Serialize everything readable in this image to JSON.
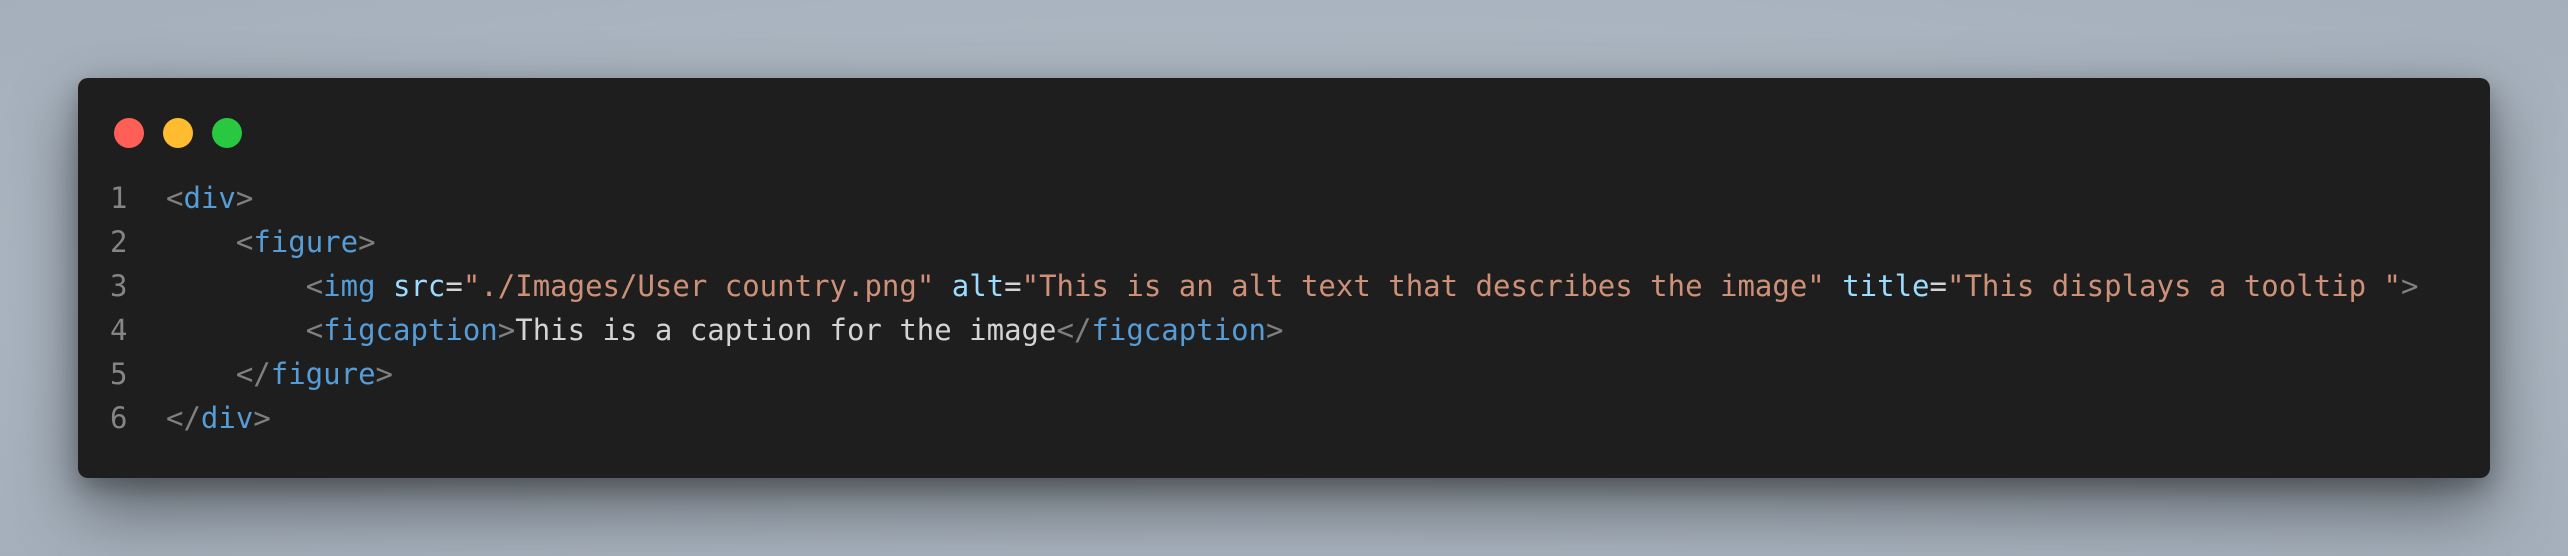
{
  "window": {
    "controls": {
      "close_color": "#ff5f57",
      "minimize_color": "#febc2e",
      "zoom_color": "#28c840"
    }
  },
  "theme": {
    "background": "#1e1e1e",
    "line_number": "#858585",
    "punctuation": "#808080",
    "tag": "#569cd6",
    "attribute": "#9cdcfe",
    "string": "#ce9178",
    "text": "#d4d4d4"
  },
  "code": {
    "lines": [
      {
        "number": "1",
        "indent": "",
        "tokens": [
          {
            "t": "punct",
            "v": "<"
          },
          {
            "t": "tag",
            "v": "div"
          },
          {
            "t": "punct",
            "v": ">"
          }
        ]
      },
      {
        "number": "2",
        "indent": "    ",
        "tokens": [
          {
            "t": "punct",
            "v": "<"
          },
          {
            "t": "tag",
            "v": "figure"
          },
          {
            "t": "punct",
            "v": ">"
          }
        ]
      },
      {
        "number": "3",
        "indent": "        ",
        "tokens": [
          {
            "t": "punct",
            "v": "<"
          },
          {
            "t": "tag",
            "v": "img"
          },
          {
            "t": "text",
            "v": " "
          },
          {
            "t": "attr",
            "v": "src"
          },
          {
            "t": "eq",
            "v": "="
          },
          {
            "t": "str",
            "v": "\"./Images/User country.png\""
          },
          {
            "t": "text",
            "v": " "
          },
          {
            "t": "attr",
            "v": "alt"
          },
          {
            "t": "eq",
            "v": "="
          },
          {
            "t": "str",
            "v": "\"This is an alt text that describes the image\""
          },
          {
            "t": "text",
            "v": " "
          },
          {
            "t": "attr",
            "v": "title"
          },
          {
            "t": "eq",
            "v": "="
          },
          {
            "t": "str",
            "v": "\"This displays a tooltip \""
          },
          {
            "t": "punct",
            "v": ">"
          }
        ]
      },
      {
        "number": "4",
        "indent": "        ",
        "tokens": [
          {
            "t": "punct",
            "v": "<"
          },
          {
            "t": "tag",
            "v": "figcaption"
          },
          {
            "t": "punct",
            "v": ">"
          },
          {
            "t": "text",
            "v": "This is a caption for the image"
          },
          {
            "t": "punct",
            "v": "</"
          },
          {
            "t": "tag",
            "v": "figcaption"
          },
          {
            "t": "punct",
            "v": ">"
          }
        ]
      },
      {
        "number": "5",
        "indent": "    ",
        "tokens": [
          {
            "t": "punct",
            "v": "</"
          },
          {
            "t": "tag",
            "v": "figure"
          },
          {
            "t": "punct",
            "v": ">"
          }
        ]
      },
      {
        "number": "6",
        "indent": "",
        "tokens": [
          {
            "t": "punct",
            "v": "</"
          },
          {
            "t": "tag",
            "v": "div"
          },
          {
            "t": "punct",
            "v": ">"
          }
        ]
      }
    ]
  }
}
